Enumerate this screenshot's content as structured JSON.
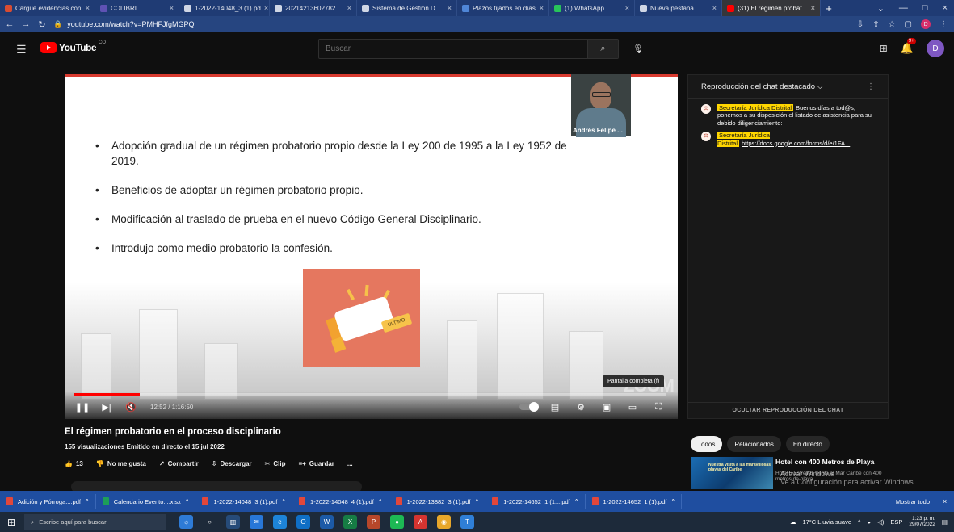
{
  "browser": {
    "tabs": [
      {
        "label": "Cargue evidencias con",
        "close": "×",
        "color": "#d84c32",
        "active": false
      },
      {
        "label": "COLIBRI",
        "close": "×",
        "color": "#5f52b4",
        "active": false
      },
      {
        "label": "1-2022-14048_3 (1).pd",
        "close": "×",
        "color": "#cfd6e5",
        "active": false
      },
      {
        "label": "20214213602782",
        "close": "×",
        "color": "#cfd6e5",
        "active": false
      },
      {
        "label": "Sistema de Gestión D",
        "close": "×",
        "color": "#cfd6e5",
        "active": false
      },
      {
        "label": "Plazos fijados en días",
        "close": "×",
        "color": "#4f86d7",
        "active": false
      },
      {
        "label": "(1) WhatsApp",
        "close": "×",
        "color": "#28c45a",
        "active": false
      },
      {
        "label": "Nueva pestaña",
        "close": "×",
        "color": "#cfd6e5",
        "active": false
      },
      {
        "label": "(31) El régimen probat",
        "close": "×",
        "color": "#ff0000",
        "active": true
      }
    ],
    "new_tab": "+",
    "url": "youtube.com/watch?v=PMHFJfgMGPQ",
    "window_controls": [
      "⌄",
      "—",
      "□",
      "×"
    ],
    "profile_initial": "D"
  },
  "youtube": {
    "logo_text": "YouTube",
    "logo_sup": "CO",
    "search_placeholder": "Buscar",
    "notifications_badge": "9+",
    "account_initial": "D"
  },
  "video": {
    "bullets": [
      "Adopción gradual de un régimen probatorio propio desde la Ley 200 de 1995 a la Ley 1952 de 2019.",
      "Beneficios de adoptar un régimen probatorio propio.",
      "Modificación al traslado de prueba en el nuevo Código General Disciplinario.",
      "Introdujo como medio probatorio la confesión."
    ],
    "webcam_name": "Andrés Felipe ...",
    "graphic_label": "ÚLTIMO",
    "progress_fraction": 0.1103,
    "time": "12:52 / 1:16:50",
    "tooltip": "Pantalla completa (f)",
    "watermark": "ZOOM"
  },
  "chat": {
    "title": "Reproducción del chat destacado ⌵",
    "messages": [
      {
        "author": "Secretaría Jurídica Distrital",
        "text": "Buenos días a tod@s, ponemos a su disposición el listado de asistencia para su debido diligenciamiento:"
      },
      {
        "author": "Secretaría Jurídica Distrital",
        "text": "https://docs.google.com/forms/d/e/1FA..."
      }
    ],
    "hide_button": "OCULTAR REPRODUCCIÓN DEL CHAT"
  },
  "info": {
    "title": "El régimen probatorio en el proceso disciplinario",
    "meta": "155 visualizaciones Emitido en directo el 15 jul 2022",
    "actions": [
      {
        "icon": "like-icon",
        "label": "13"
      },
      {
        "icon": "dislike-icon",
        "label": "No me gusta"
      },
      {
        "icon": "share-icon",
        "label": "Compartir"
      },
      {
        "icon": "download-icon",
        "label": "Descargar"
      },
      {
        "icon": "clip-icon",
        "label": "Clip"
      },
      {
        "icon": "save-icon",
        "label": "Guardar"
      },
      {
        "icon": "more-icon",
        "label": "..."
      }
    ]
  },
  "recommendations": {
    "chips": [
      "Todos",
      "Relacionados",
      "En directo"
    ],
    "item": {
      "title": "Hotel con 400 Metros de Playa",
      "subtitle": "Hotel 5 Estrellas frente al Mar Caribe con 400 metros de playa",
      "thumb_text": "Nuestra visita a las maravillosas playas del Caribe"
    }
  },
  "activation": {
    "line1": "Activar Windows",
    "line2": "Ve a Configuración para activar Windows."
  },
  "downloads": [
    {
      "name": "Adición y Pórroga....pdf",
      "type": "pdf"
    },
    {
      "name": "Calendario Evento....xlsx",
      "type": "excel"
    },
    {
      "name": "1-2022-14048_3 (1).pdf",
      "type": "pdf"
    },
    {
      "name": "1-2022-14048_4 (1).pdf",
      "type": "pdf"
    },
    {
      "name": "1-2022-13882_3 (1).pdf",
      "type": "pdf"
    },
    {
      "name": "1-2022-14652_1 (1....pdf",
      "type": "pdf"
    },
    {
      "name": "1-2022-14652_1 (1).pdf",
      "type": "pdf"
    }
  ],
  "download_bar": {
    "show_all": "Mostrar todo",
    "close": "×"
  },
  "taskbar": {
    "search": "Escribe aquí para buscar",
    "weather": "17°C Lluvia suave",
    "lang": "ESP",
    "time": "1:23 p. m.",
    "date": "29/07/2022"
  }
}
